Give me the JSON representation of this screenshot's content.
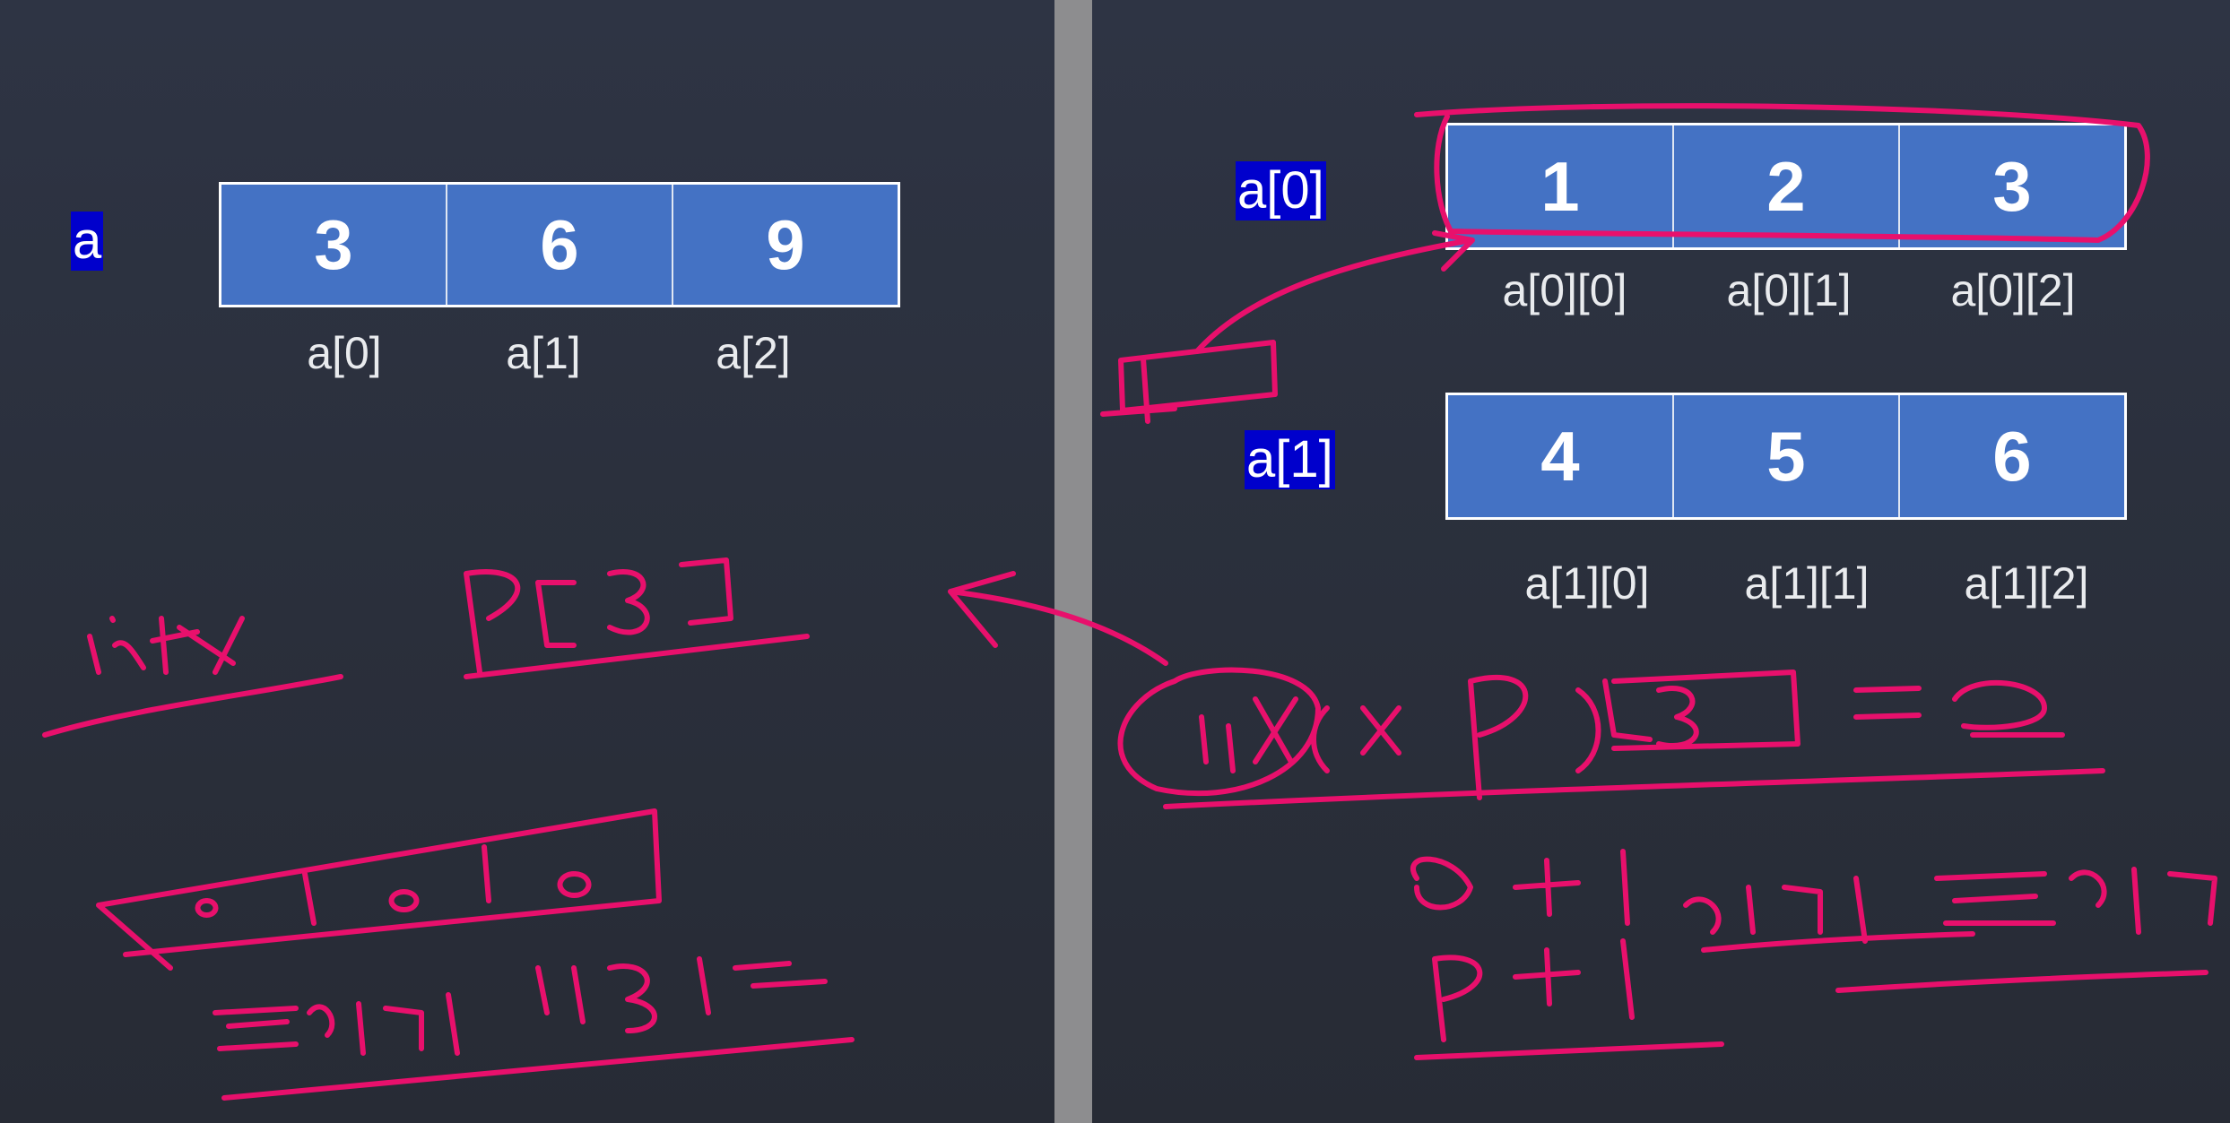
{
  "left": {
    "var_label": "a",
    "values": [
      "3",
      "6",
      "9"
    ],
    "indices": [
      "a[0]",
      "a[1]",
      "a[2]"
    ]
  },
  "right": {
    "rows": [
      {
        "label": "a[0]",
        "values": [
          "1",
          "2",
          "3"
        ],
        "indices": [
          "a[0][0]",
          "a[0][1]",
          "a[0][2]"
        ]
      },
      {
        "label": "a[1]",
        "values": [
          "4",
          "5",
          "6"
        ],
        "indices": [
          "a[1][0]",
          "a[1][1]",
          "a[1][2]"
        ]
      }
    ]
  },
  "colors": {
    "cell_fill": "#4472c4",
    "label_highlight": "#0000cc",
    "ink": "#e8106c",
    "divider": "#8d8d8f"
  }
}
